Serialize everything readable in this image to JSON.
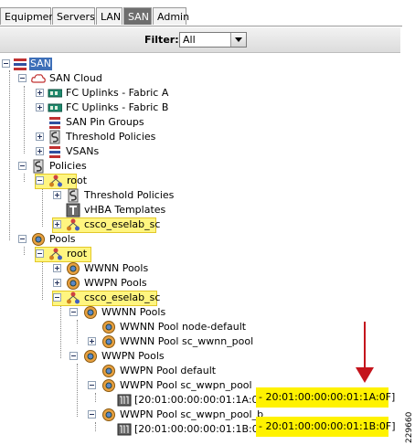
{
  "tabs": [
    {
      "label": "Equipment"
    },
    {
      "label": "Servers"
    },
    {
      "label": "LAN"
    },
    {
      "label": "SAN",
      "active": true
    },
    {
      "label": "Admin"
    }
  ],
  "filter": {
    "label": "Filter:",
    "value": "All"
  },
  "tree": [
    {
      "label": "SAN",
      "icon": "san-icon",
      "expanded": true,
      "selected": true
    },
    {
      "label": "SAN Cloud",
      "icon": "cloud-icon",
      "expanded": true
    },
    {
      "label": "FC Uplinks - Fabric A",
      "icon": "fc-uplink-icon",
      "expanded": false
    },
    {
      "label": "FC Uplinks - Fabric B",
      "icon": "fc-uplink-icon",
      "expanded": false
    },
    {
      "label": "SAN Pin Groups",
      "icon": "pin-group-icon"
    },
    {
      "label": "Threshold Policies",
      "icon": "threshold-icon",
      "expanded": false
    },
    {
      "label": "VSANs",
      "icon": "vsan-icon",
      "expanded": false
    },
    {
      "label": "Policies",
      "icon": "policy-icon",
      "expanded": true
    },
    {
      "label": "root",
      "icon": "org-icon",
      "expanded": true,
      "highlighted": true
    },
    {
      "label": "Threshold Policies",
      "icon": "threshold-icon",
      "expanded": false
    },
    {
      "label": "vHBA Templates",
      "icon": "template-icon"
    },
    {
      "label": "csco_eselab_sc",
      "icon": "org-icon",
      "expanded": false,
      "highlighted": true
    },
    {
      "label": "Pools",
      "icon": "pool-icon",
      "expanded": true
    },
    {
      "label": "root",
      "icon": "org-icon",
      "expanded": true,
      "highlighted": true
    },
    {
      "label": "WWNN Pools",
      "icon": "pool-icon",
      "expanded": false
    },
    {
      "label": "WWPN Pools",
      "icon": "pool-icon",
      "expanded": false
    },
    {
      "label": "csco_eselab_sc",
      "icon": "org-icon",
      "expanded": true,
      "highlighted": true
    },
    {
      "label": "WWNN Pools",
      "icon": "pool-icon",
      "expanded": true
    },
    {
      "label": "WWNN Pool node-default",
      "icon": "pool-icon"
    },
    {
      "label": "WWNN Pool sc_wwnn_pool",
      "icon": "pool-icon",
      "expanded": false
    },
    {
      "label": "WWPN Pools",
      "icon": "pool-icon",
      "expanded": true
    },
    {
      "label": "WWPN Pool default",
      "icon": "pool-icon"
    },
    {
      "label": "WWPN Pool sc_wwpn_pool",
      "icon": "pool-icon",
      "expanded": true
    },
    {
      "label_start": "[20:01:00:00:00:01:1A:00",
      "label_end": " - 20:01:00:00:00:01:1A:0F]",
      "icon": "block-icon"
    },
    {
      "label": "WWPN Pool sc_wwpn_pool_b",
      "icon": "pool-icon",
      "expanded": true
    },
    {
      "label_start": "[20:01:00:00:00:01:1B:00",
      "label_end": " - 20:01:00:00:00:01:1B:0F]",
      "icon": "block-icon"
    }
  ],
  "figure_id": "229660",
  "colors": {
    "selection": "#3d6fb8",
    "highlight": "#fff200",
    "arrow": "#c4141c"
  }
}
